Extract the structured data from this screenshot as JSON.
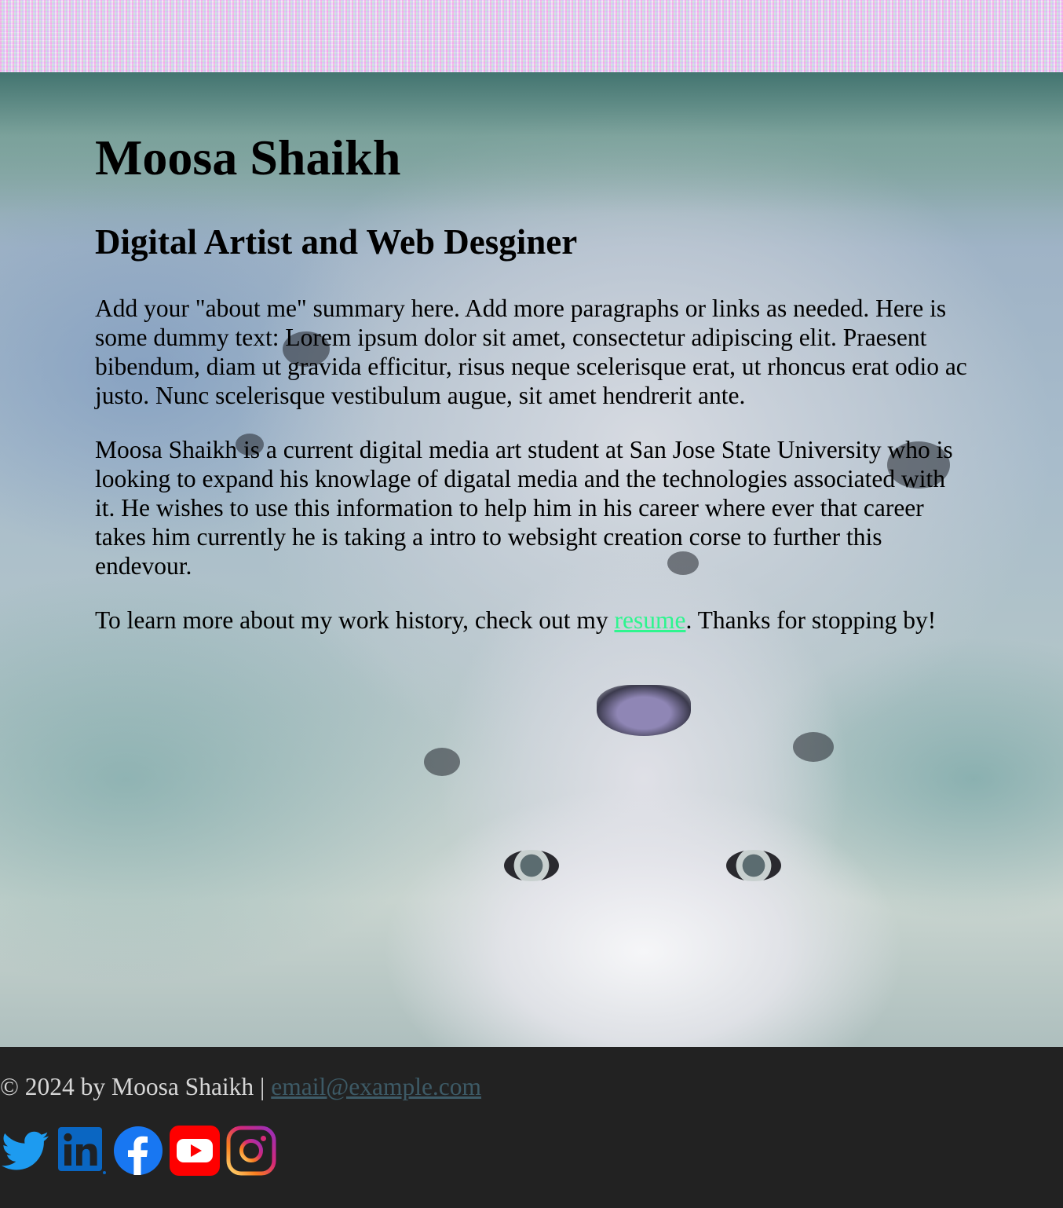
{
  "header": {
    "name": "Moosa Shaikh",
    "tagline": "Digital Artist and Web Desginer"
  },
  "about": {
    "paragraph_1": "Add your \"about me\" summary here. Add more paragraphs or links as needed. Here is some dummy text: Lorem ipsum dolor sit amet, consectetur adipiscing elit. Praesent bibendum, diam ut gravida efficitur, risus neque scelerisque erat, ut rhoncus erat odio ac justo. Nunc scelerisque vestibulum augue, sit amet hendrerit ante.",
    "paragraph_2": "Moosa Shaikh is a current digital media art student at San Jose State University who is looking to expand his knowlage of digatal media and the technologies associated with it. He wishes to use this information to help him in his career where ever that career takes him currently he is taking a intro to websight creation corse to further this endevour.",
    "paragraph_3_before": "To learn more about my work history, check out my ",
    "resume_link": "resume",
    "paragraph_3_after": ". Thanks for stopping by!"
  },
  "footer": {
    "copyright": "© 2024 by Moosa Shaikh | ",
    "email": "email@example.com",
    "social": [
      {
        "icon": "twitter-icon"
      },
      {
        "icon": "linkedin-icon"
      },
      {
        "icon": "facebook-icon"
      },
      {
        "icon": "youtube-icon"
      },
      {
        "icon": "instagram-icon"
      }
    ]
  },
  "colors": {
    "link": "#2ef58f",
    "footer_bg": "#222222",
    "email_link": "#3d5a66",
    "twitter": "#1d9bf0",
    "linkedin": "#0a66c2",
    "facebook": "#1877f2",
    "youtube": "#ff0000"
  }
}
